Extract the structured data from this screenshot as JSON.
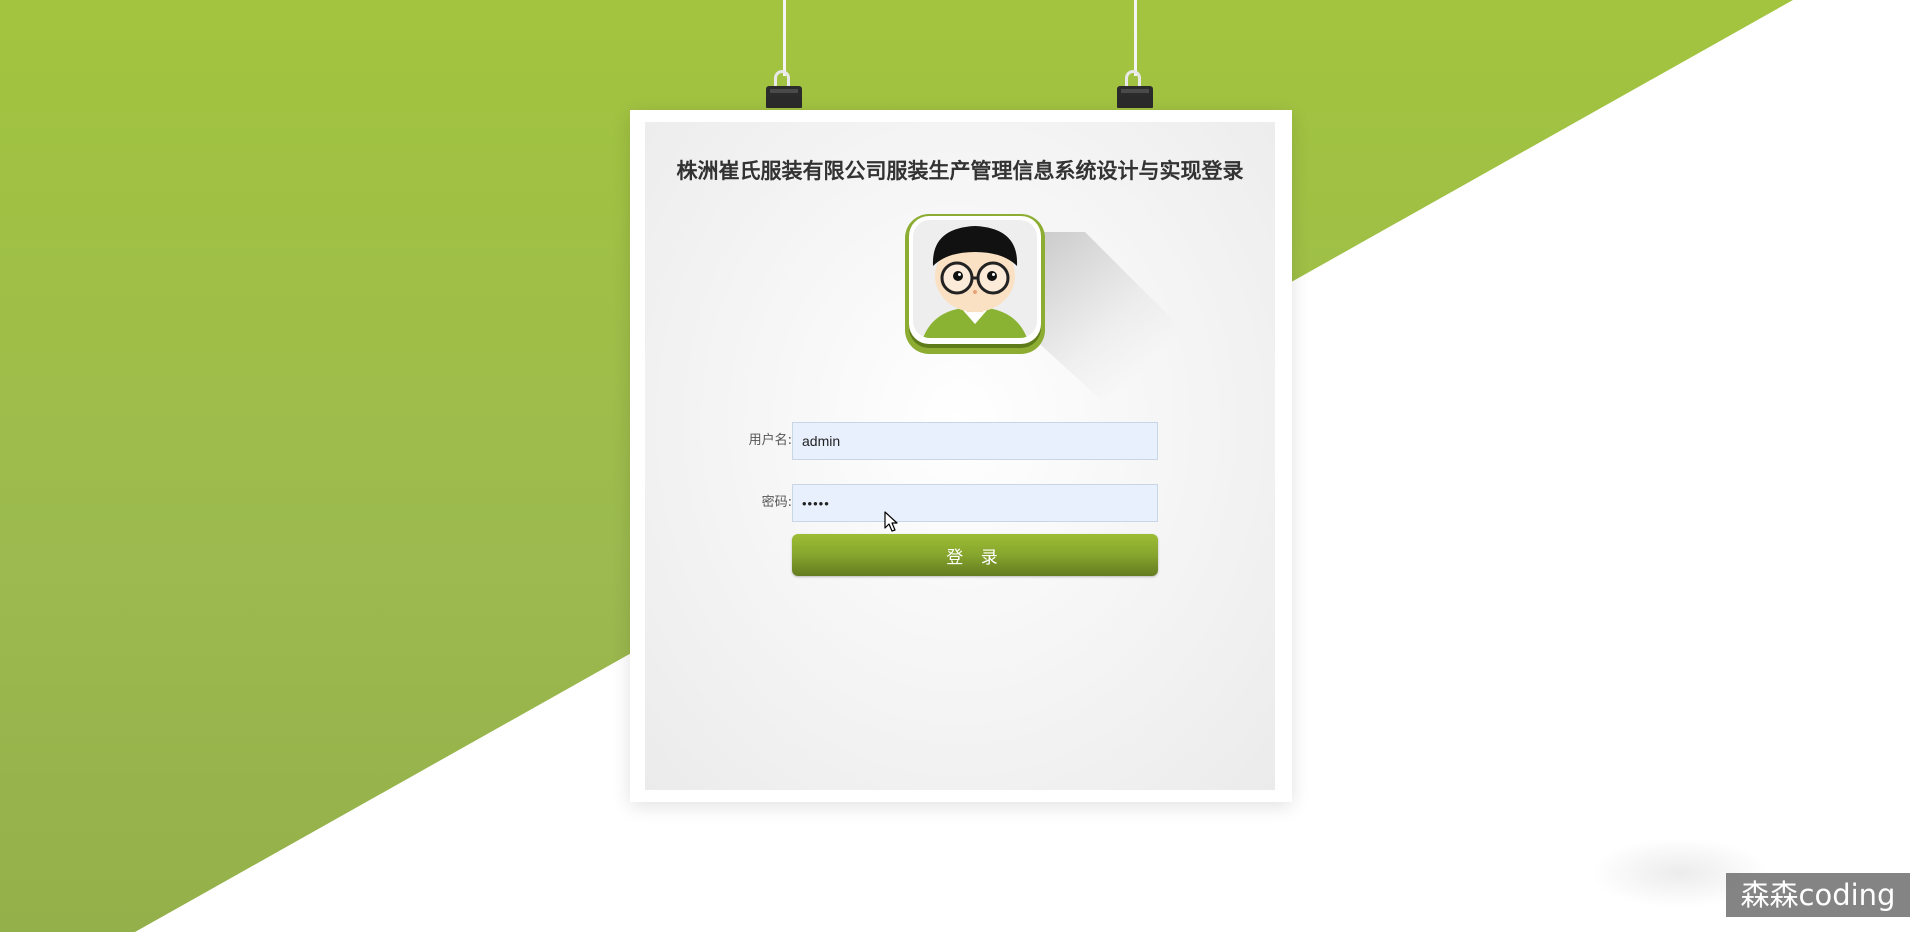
{
  "page": {
    "title": "株洲崔氏服装有限公司服装生产管理信息系统设计与实现登录"
  },
  "login_form": {
    "username_label": "用户名:",
    "username_value": "admin",
    "password_label": "密码:",
    "password_value": "•••••",
    "submit_label": "登 录"
  },
  "watermark": {
    "text": "森森coding"
  },
  "colors": {
    "accent_green": "#a2c43e",
    "button_green_dark": "#647c20",
    "input_background": "#e8f0fe"
  },
  "icons": {
    "avatar": "cartoon-user-avatar",
    "clips": "binder-clip",
    "cursor": "mouse-pointer"
  }
}
